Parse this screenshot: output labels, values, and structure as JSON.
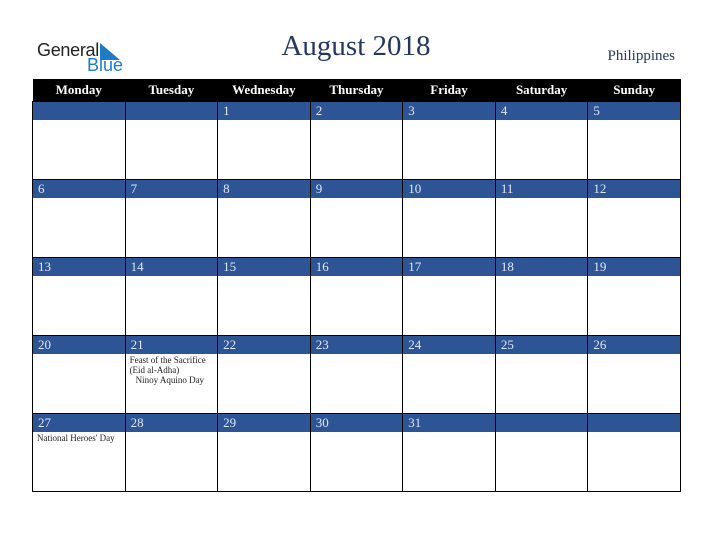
{
  "logo": {
    "general": "General",
    "blue": "Blue"
  },
  "title": "August 2018",
  "country": "Philippines",
  "colors": {
    "header_bg": "#000000",
    "band": "#2d5596",
    "title": "#24385f",
    "logo_blue": "#1f7bc6"
  },
  "weekdays": [
    "Monday",
    "Tuesday",
    "Wednesday",
    "Thursday",
    "Friday",
    "Saturday",
    "Sunday"
  ],
  "weeks": [
    [
      {
        "day": "",
        "events": []
      },
      {
        "day": "",
        "events": []
      },
      {
        "day": "1",
        "events": []
      },
      {
        "day": "2",
        "events": []
      },
      {
        "day": "3",
        "events": []
      },
      {
        "day": "4",
        "events": []
      },
      {
        "day": "5",
        "events": []
      }
    ],
    [
      {
        "day": "6",
        "events": []
      },
      {
        "day": "7",
        "events": []
      },
      {
        "day": "8",
        "events": []
      },
      {
        "day": "9",
        "events": []
      },
      {
        "day": "10",
        "events": []
      },
      {
        "day": "11",
        "events": []
      },
      {
        "day": "12",
        "events": []
      }
    ],
    [
      {
        "day": "13",
        "events": []
      },
      {
        "day": "14",
        "events": []
      },
      {
        "day": "15",
        "events": []
      },
      {
        "day": "16",
        "events": []
      },
      {
        "day": "17",
        "events": []
      },
      {
        "day": "18",
        "events": []
      },
      {
        "day": "19",
        "events": []
      }
    ],
    [
      {
        "day": "20",
        "events": []
      },
      {
        "day": "21",
        "events": [
          "Feast of the Sacrifice (Eid al-Adha)",
          "Ninoy Aquino Day"
        ]
      },
      {
        "day": "22",
        "events": []
      },
      {
        "day": "23",
        "events": []
      },
      {
        "day": "24",
        "events": []
      },
      {
        "day": "25",
        "events": []
      },
      {
        "day": "26",
        "events": []
      }
    ],
    [
      {
        "day": "27",
        "events": [
          "National Heroes' Day"
        ]
      },
      {
        "day": "28",
        "events": []
      },
      {
        "day": "29",
        "events": []
      },
      {
        "day": "30",
        "events": []
      },
      {
        "day": "31",
        "events": []
      },
      {
        "day": "",
        "events": []
      },
      {
        "day": "",
        "events": []
      }
    ]
  ]
}
